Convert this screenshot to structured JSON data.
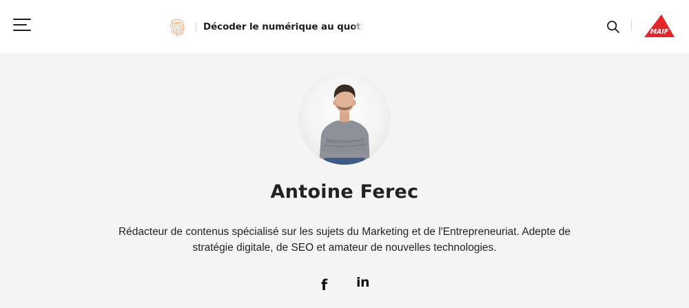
{
  "header": {
    "tagline": "Décoder le numérique au quotidien",
    "logo_text": "MAIF",
    "colors": {
      "logo_red": "#e3262b",
      "fingerprint": "#f1a87c"
    },
    "icons": [
      "menu-icon",
      "fingerprint-icon",
      "search-icon",
      "maif-logo"
    ]
  },
  "author": {
    "name": "Antoine Ferec",
    "bio": "Rédacteur de contenus spécialisé sur les sujets du Marketing et de l'Entrepreneuriat. Adepte de stratégie digitale, de SEO et amateur de nouvelles technologies.",
    "social": {
      "facebook": "f",
      "linkedin": "in"
    }
  }
}
